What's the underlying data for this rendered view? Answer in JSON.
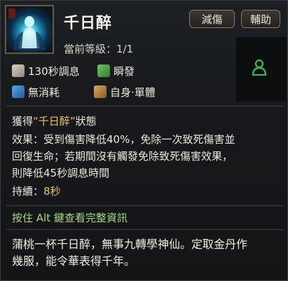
{
  "skill": {
    "name": "千日醉",
    "level_label": "當前等級：",
    "level_value": "1/1",
    "icon": "glowing-figure-skill-icon"
  },
  "tags": [
    "減傷",
    "輔助"
  ],
  "side_icon": "person-icon",
  "attributes": [
    {
      "icon": "clock-icon",
      "label": "130秒調息"
    },
    {
      "icon": "green-instant-icon",
      "label": "瞬發"
    },
    {
      "icon": "blue-cost-icon",
      "label": "無消耗"
    },
    {
      "icon": "target-self-icon",
      "label": "自身·單體"
    }
  ],
  "description": {
    "line1_prefix": "獲得",
    "line1_quote_open": "“",
    "line1_highlight": "千日醉",
    "line1_quote_close": "”",
    "line1_suffix": "狀態",
    "effect_label": "效果：",
    "effect_text_1": "受到傷害降低40%，免除一次致死傷害並",
    "effect_text_2": "回復生命；若期間沒有觸發免除致死傷害效果，",
    "effect_text_3": "則降低45秒調息時間",
    "duration_label": "持續：",
    "duration_value": "8秒"
  },
  "hint": {
    "prefix": "按住 ",
    "key": "Alt",
    "suffix": " 鍵查看完整資訊"
  },
  "flavor": {
    "line1": "蒲桃一杯千日醉，無事九轉學神仙。定取金丹作",
    "line2": "幾服，能令華表得千年。"
  },
  "colors": {
    "highlight": "#e4c36a",
    "hint": "#a8d87a",
    "tag_border": "#8a7a5a",
    "person_icon": "#3fae55"
  }
}
